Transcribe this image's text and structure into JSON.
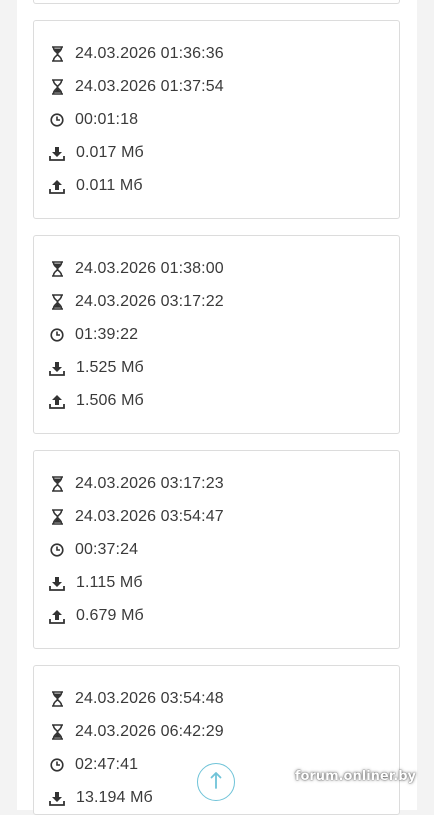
{
  "sessions": [
    {
      "start": "24.03.2026 01:36:36",
      "end": "24.03.2026 01:37:54",
      "duration": "00:01:18",
      "download": "0.017 Мб",
      "upload": "0.011 Мб"
    },
    {
      "start": "24.03.2026 01:38:00",
      "end": "24.03.2026 03:17:22",
      "duration": "01:39:22",
      "download": "1.525 Мб",
      "upload": "1.506 Мб"
    },
    {
      "start": "24.03.2026 03:17:23",
      "end": "24.03.2026 03:54:47",
      "duration": "00:37:24",
      "download": "1.115 Мб",
      "upload": "0.679 Мб"
    },
    {
      "start": "24.03.2026 03:54:48",
      "end": "24.03.2026 06:42:29",
      "duration": "02:47:41",
      "download": "13.194 Мб",
      "upload": ""
    }
  ],
  "watermark": "forum.onliner.by",
  "icons": {
    "start": "hourglass-start-icon",
    "end": "hourglass-end-icon",
    "duration": "clock-icon",
    "download": "download-icon",
    "upload": "upload-icon",
    "scroll": "arrow-up-icon"
  },
  "colors": {
    "icon": "#333333",
    "accent": "#6fc3d8",
    "border": "#dcdcdc"
  }
}
